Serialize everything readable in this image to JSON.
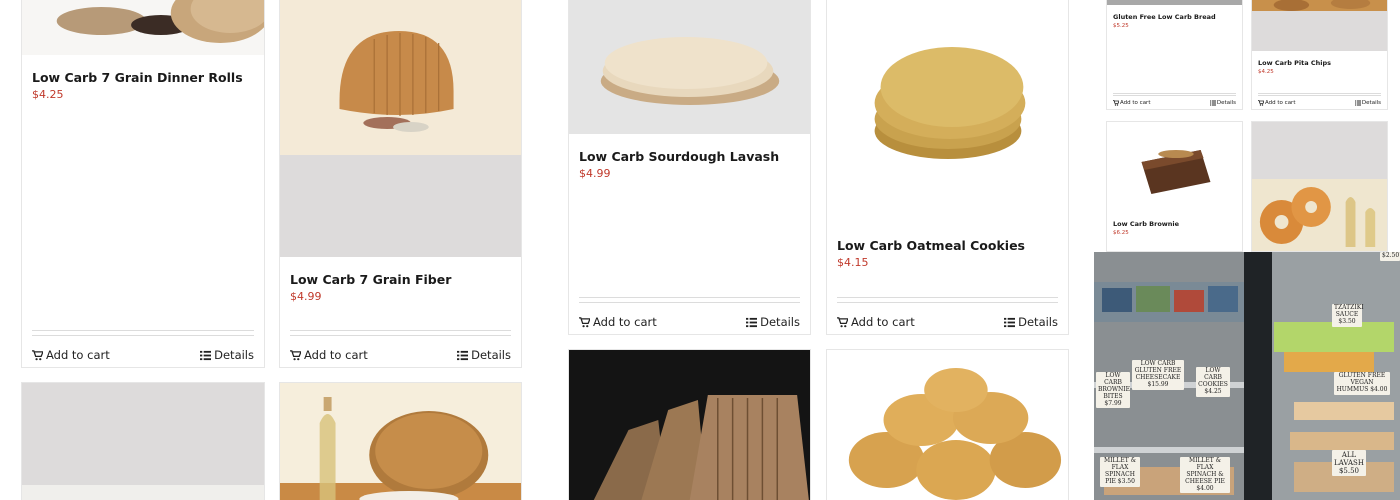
{
  "actions": {
    "add_to_cart": "Add to cart",
    "details": "Details"
  },
  "icons": {
    "cart": "shopping-cart-icon",
    "details": "list-icon"
  },
  "colors": {
    "price": "#c0392b",
    "name": "#1a1a1a",
    "border": "#e6e6e6"
  },
  "products": [
    {
      "name": "Low Carb 7 Grain Dinner Rolls",
      "price": "$4.25"
    },
    {
      "name": "Low Carb 7 Grain Fiber",
      "price": "$4.99"
    },
    {
      "name": "Low Carb Sourdough Lavash",
      "price": "$4.99"
    },
    {
      "name": "Low Carb Oatmeal Cookies",
      "price": "$4.15"
    }
  ],
  "mini_products": [
    {
      "name": "Gluten Free Low Carb Bread",
      "price": "$5.25"
    },
    {
      "name": "Low Carb Pita Chips",
      "price": "$4.25"
    },
    {
      "name": "Low Carb Brownie",
      "price": "$6.25"
    }
  ],
  "fridge_tags": [
    {
      "text": "TZATZIKI SAUCE $3.50"
    },
    {
      "text": "LOW CARB COOKIES $4.25"
    },
    {
      "text": "LOW CARB GLUTEN FREE CHEESECAKE $15.99"
    },
    {
      "text": "GLUTEN FREE VEGAN HUMMUS $4.00"
    },
    {
      "text": "LOW CARB BROWNIE BITES $7.99"
    },
    {
      "text": "MILLET & FLAX SPINACH PIE $3.50"
    },
    {
      "text": "MILLET & FLAX SPINACH & CHEESE PIE $4.00"
    },
    {
      "text": "ALL LAVASH $5.50"
    },
    {
      "text": "$2.50"
    }
  ]
}
